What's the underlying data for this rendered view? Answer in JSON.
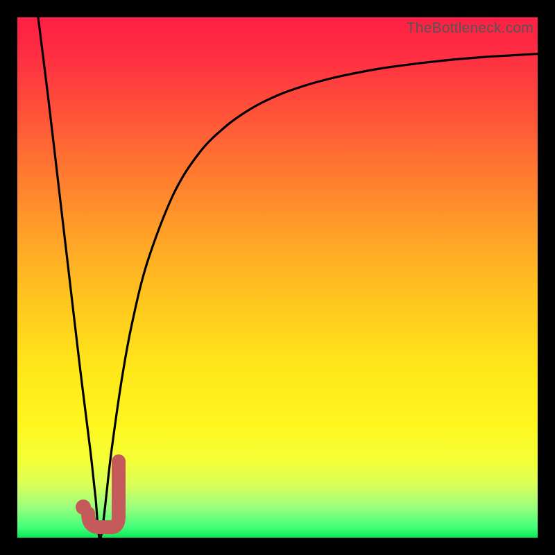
{
  "watermark": "TheBottleneck.com",
  "colors": {
    "frame": "#000000",
    "curve": "#000000",
    "callout": "#c55a5a",
    "gradient_top": "#ff1f45",
    "gradient_bottom": "#09ea54"
  },
  "chart_data": {
    "type": "line",
    "title": "",
    "xlabel": "",
    "ylabel": "",
    "xlim": [
      0,
      100
    ],
    "ylim": [
      0,
      100
    ],
    "grid": false,
    "legend": false,
    "series": [
      {
        "name": "bottleneck-curve",
        "x": [
          4,
          6,
          8,
          10,
          12,
          14,
          15,
          16,
          18,
          20,
          22,
          25,
          30,
          35,
          40,
          45,
          50,
          55,
          60,
          65,
          70,
          75,
          80,
          85,
          90,
          95,
          100
        ],
        "y": [
          100,
          84,
          67,
          50,
          33,
          17,
          8,
          0,
          16,
          30,
          41,
          53,
          66,
          74,
          79,
          82.5,
          85,
          86.8,
          88.2,
          89.3,
          90.2,
          90.9,
          91.5,
          92,
          92.4,
          92.7,
          93
        ]
      }
    ],
    "annotations": [
      {
        "name": "callout-j",
        "shape": "J",
        "x_range": [
          13,
          19
        ],
        "y_range": [
          0,
          16
        ]
      }
    ]
  }
}
